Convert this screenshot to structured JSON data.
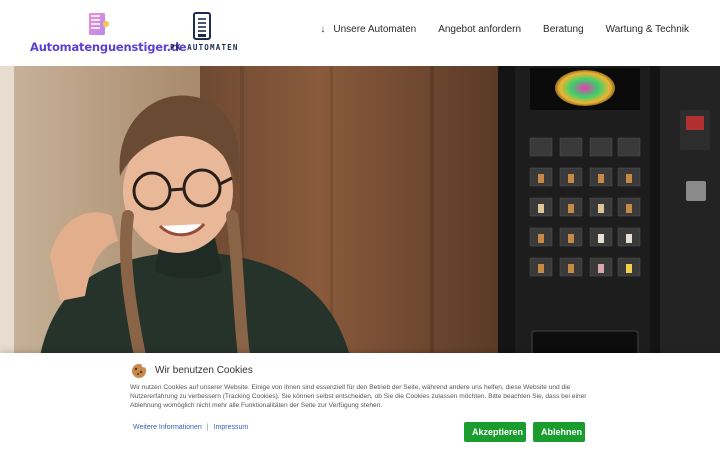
{
  "header": {
    "logo_left_text": "Automatenguenstiger.de",
    "logo_right_text": "PK AUTOMATEN"
  },
  "nav": {
    "items": [
      {
        "label": "Unsere Automaten",
        "arrow": "↓"
      },
      {
        "label": "Angebot anfordern"
      },
      {
        "label": "Beratung"
      },
      {
        "label": "Wartung & Technik"
      }
    ]
  },
  "cookie": {
    "title": "Wir benutzen Cookies",
    "text": "Wir nutzen Cookies auf unserer Website. Einige von ihnen sind essenziell für den Betrieb der Seite, während andere uns helfen, diese Website und die Nutzererfahrung zu verbessern (Tracking Cookies). Sie können selbst entscheiden, ob Sie die Cookies zulassen möchten. Bitte beachten Sie, dass bei einer Ablehnung womöglich nicht mehr alle Funktionalitäten der Seite zur Verfügung stehen.",
    "link_more": "Weitere Informationen",
    "separator": "|",
    "link_imprint": "Impressum",
    "accept_label": "Akzeptieren",
    "decline_label": "Ablehnen"
  },
  "colors": {
    "accept": "#1a9d2e",
    "link": "#3a62b8",
    "brand": "#5b3fd6"
  }
}
